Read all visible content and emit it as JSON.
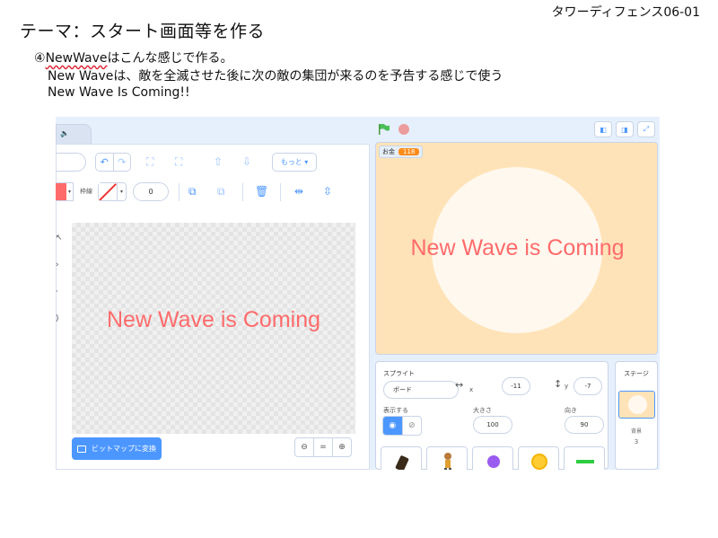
{
  "doc": {
    "id": "タワーディフェンス06-01",
    "title": "テーマ：スタート画面等を作る",
    "step_prefix": "④",
    "step_word": "NewWave",
    "step_rest": "はこんな感じで作る。",
    "line2": "New Waveは、敵を全滅させた後に次の敵の集団が来るのを予告する感じで使う",
    "line3": "New Wave Is Coming!!"
  },
  "editor": {
    "more_label": "もっと",
    "outline_label": "枠線",
    "outline_width": "0",
    "canvas_text": "New Wave is Coming",
    "bitmap_button": "ビットマップに変換",
    "zoom_out": "⊖",
    "zoom_reset": "=",
    "zoom_in": "⊕"
  },
  "stage": {
    "variable_name": "お金",
    "variable_value": "118",
    "text": "New Wave is Coming"
  },
  "sprite_info": {
    "sprite_label": "スプライト",
    "sprite_name": "ボード",
    "x_label": "x",
    "x_value": "-11",
    "y_label": "y",
    "y_value": "-7",
    "show_label": "表示する",
    "size_label": "大きさ",
    "size_value": "100",
    "direction_label": "向き",
    "direction_value": "90"
  },
  "stage_panel": {
    "title": "ステージ",
    "backdrop_label": "背景",
    "backdrop_count": "3"
  },
  "colors": {
    "accent": "#4c97ff",
    "text_red": "#ff6b6b",
    "stage_bg": "#ffe3b8",
    "variable_orange": "#ff8c1a"
  }
}
